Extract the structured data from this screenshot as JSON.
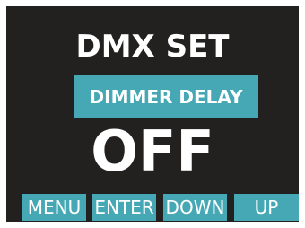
{
  "display": {
    "title": "DMX SET",
    "parameter": "DIMMER DELAY",
    "value": "OFF"
  },
  "buttons": {
    "menu": "MENU",
    "enter": "ENTER",
    "down": "DOWN",
    "up": "UP"
  },
  "colors": {
    "screen_background": "#232020",
    "accent": "#46a8b4",
    "text": "#ffffff"
  }
}
